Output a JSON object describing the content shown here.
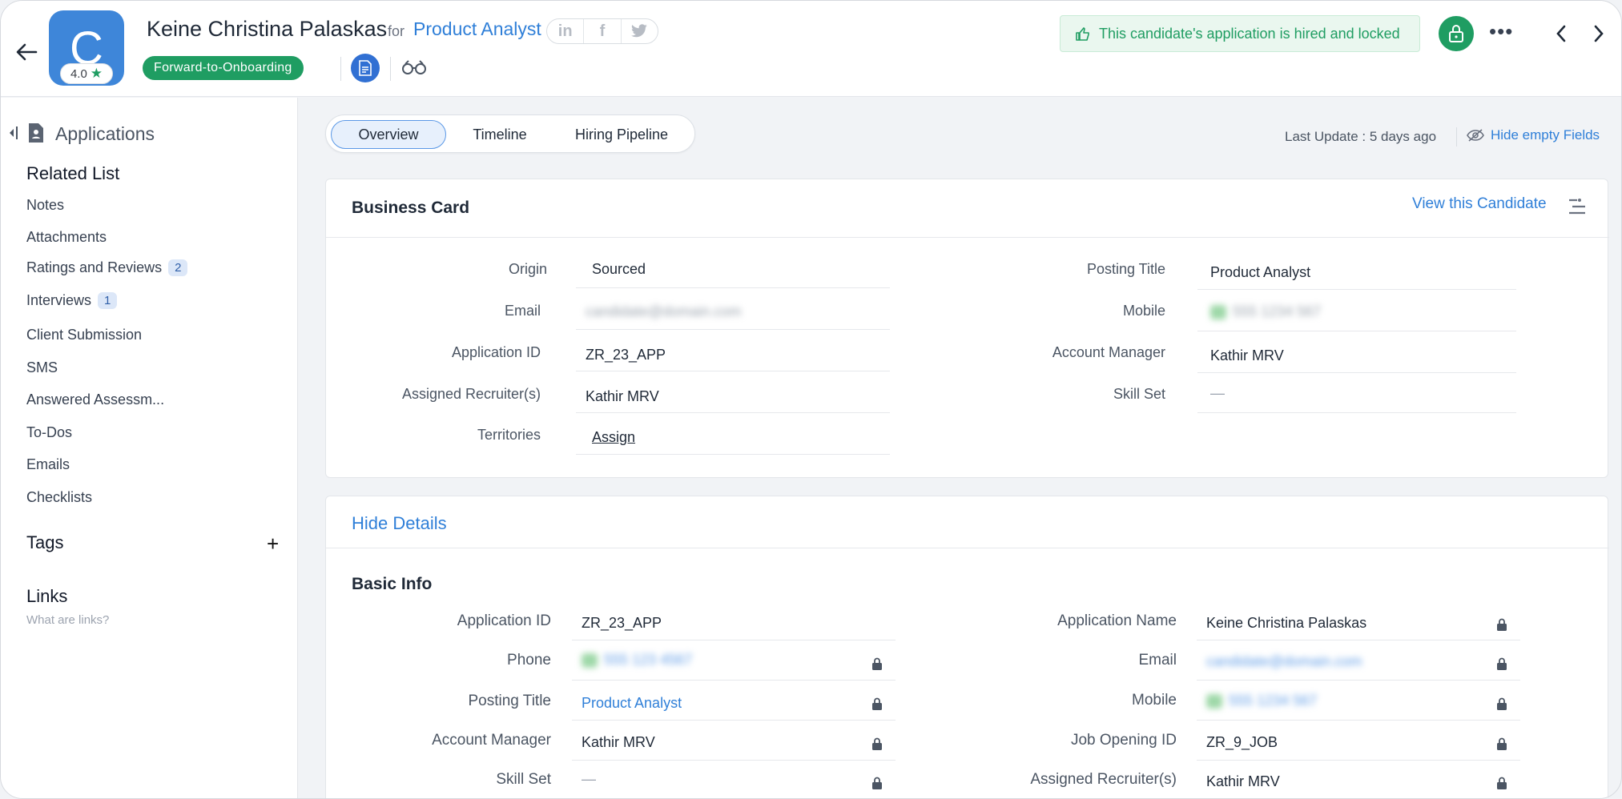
{
  "header": {
    "avatar_letter": "C",
    "rating": "4.0",
    "candidate_name": "Keine Christina Palaskas",
    "for_word": "for",
    "job_title": "Product Analyst",
    "social": [
      "in",
      "f",
      "t"
    ],
    "stage": "Forward-to-Onboarding",
    "locked_message": "This candidate's application is hired and locked",
    "more": "•••"
  },
  "sidebar": {
    "title": "Applications",
    "related_heading": "Related List",
    "items": [
      {
        "label": "Notes",
        "count": ""
      },
      {
        "label": "Attachments",
        "count": ""
      },
      {
        "label": "Ratings and Reviews",
        "count": "2"
      },
      {
        "label": "Interviews",
        "count": "1"
      },
      {
        "label": "Client Submission",
        "count": ""
      },
      {
        "label": "SMS",
        "count": ""
      },
      {
        "label": "Answered Assessm...",
        "count": ""
      },
      {
        "label": "To-Dos",
        "count": ""
      },
      {
        "label": "Emails",
        "count": ""
      },
      {
        "label": "Checklists",
        "count": ""
      }
    ],
    "tags_heading": "Tags",
    "tags_add": "+",
    "links_heading": "Links",
    "links_sub": "What are links?"
  },
  "tabs": [
    "Overview",
    "Timeline",
    "Hiring Pipeline"
  ],
  "toolbar": {
    "last_update": "Last Update : 5 days ago",
    "hide_empty": "Hide empty Fields"
  },
  "business_card": {
    "title": "Business Card",
    "view_link": "View this Candidate",
    "left": [
      {
        "label": "Origin",
        "value": "Sourced"
      },
      {
        "label": "Email",
        "value": "candidate@domain.com"
      },
      {
        "label": "Application ID",
        "value": "ZR_23_APP"
      },
      {
        "label": "Assigned Recruiter(s)",
        "value": "Kathir MRV"
      },
      {
        "label": "Territories",
        "value": "Assign"
      }
    ],
    "right": [
      {
        "label": "Posting Title",
        "value": "Product Analyst"
      },
      {
        "label": "Mobile",
        "value": "555 1234 567"
      },
      {
        "label": "Account Manager",
        "value": "Kathir MRV"
      },
      {
        "label": "Skill Set",
        "value": "—"
      }
    ]
  },
  "details": {
    "hide_link": "Hide Details",
    "section_title": "Basic Info",
    "left": [
      {
        "label": "Application ID",
        "value": "ZR_23_APP"
      },
      {
        "label": "Phone",
        "value": "555 123 4567"
      },
      {
        "label": "Posting Title",
        "value": "Product Analyst"
      },
      {
        "label": "Account Manager",
        "value": "Kathir MRV"
      },
      {
        "label": "Skill Set",
        "value": "—"
      }
    ],
    "right": [
      {
        "label": "Application Name",
        "value": "Keine Christina Palaskas"
      },
      {
        "label": "Email",
        "value": "candidate@domain.com"
      },
      {
        "label": "Mobile",
        "value": "555 1234 567"
      },
      {
        "label": "Job Opening ID",
        "value": "ZR_9_JOB"
      },
      {
        "label": "Assigned Recruiter(s)",
        "value": "Kathir MRV"
      }
    ]
  },
  "colors": {
    "accent": "#2f7fd8",
    "success": "#1f9d62",
    "avatar": "#3e86d9"
  }
}
